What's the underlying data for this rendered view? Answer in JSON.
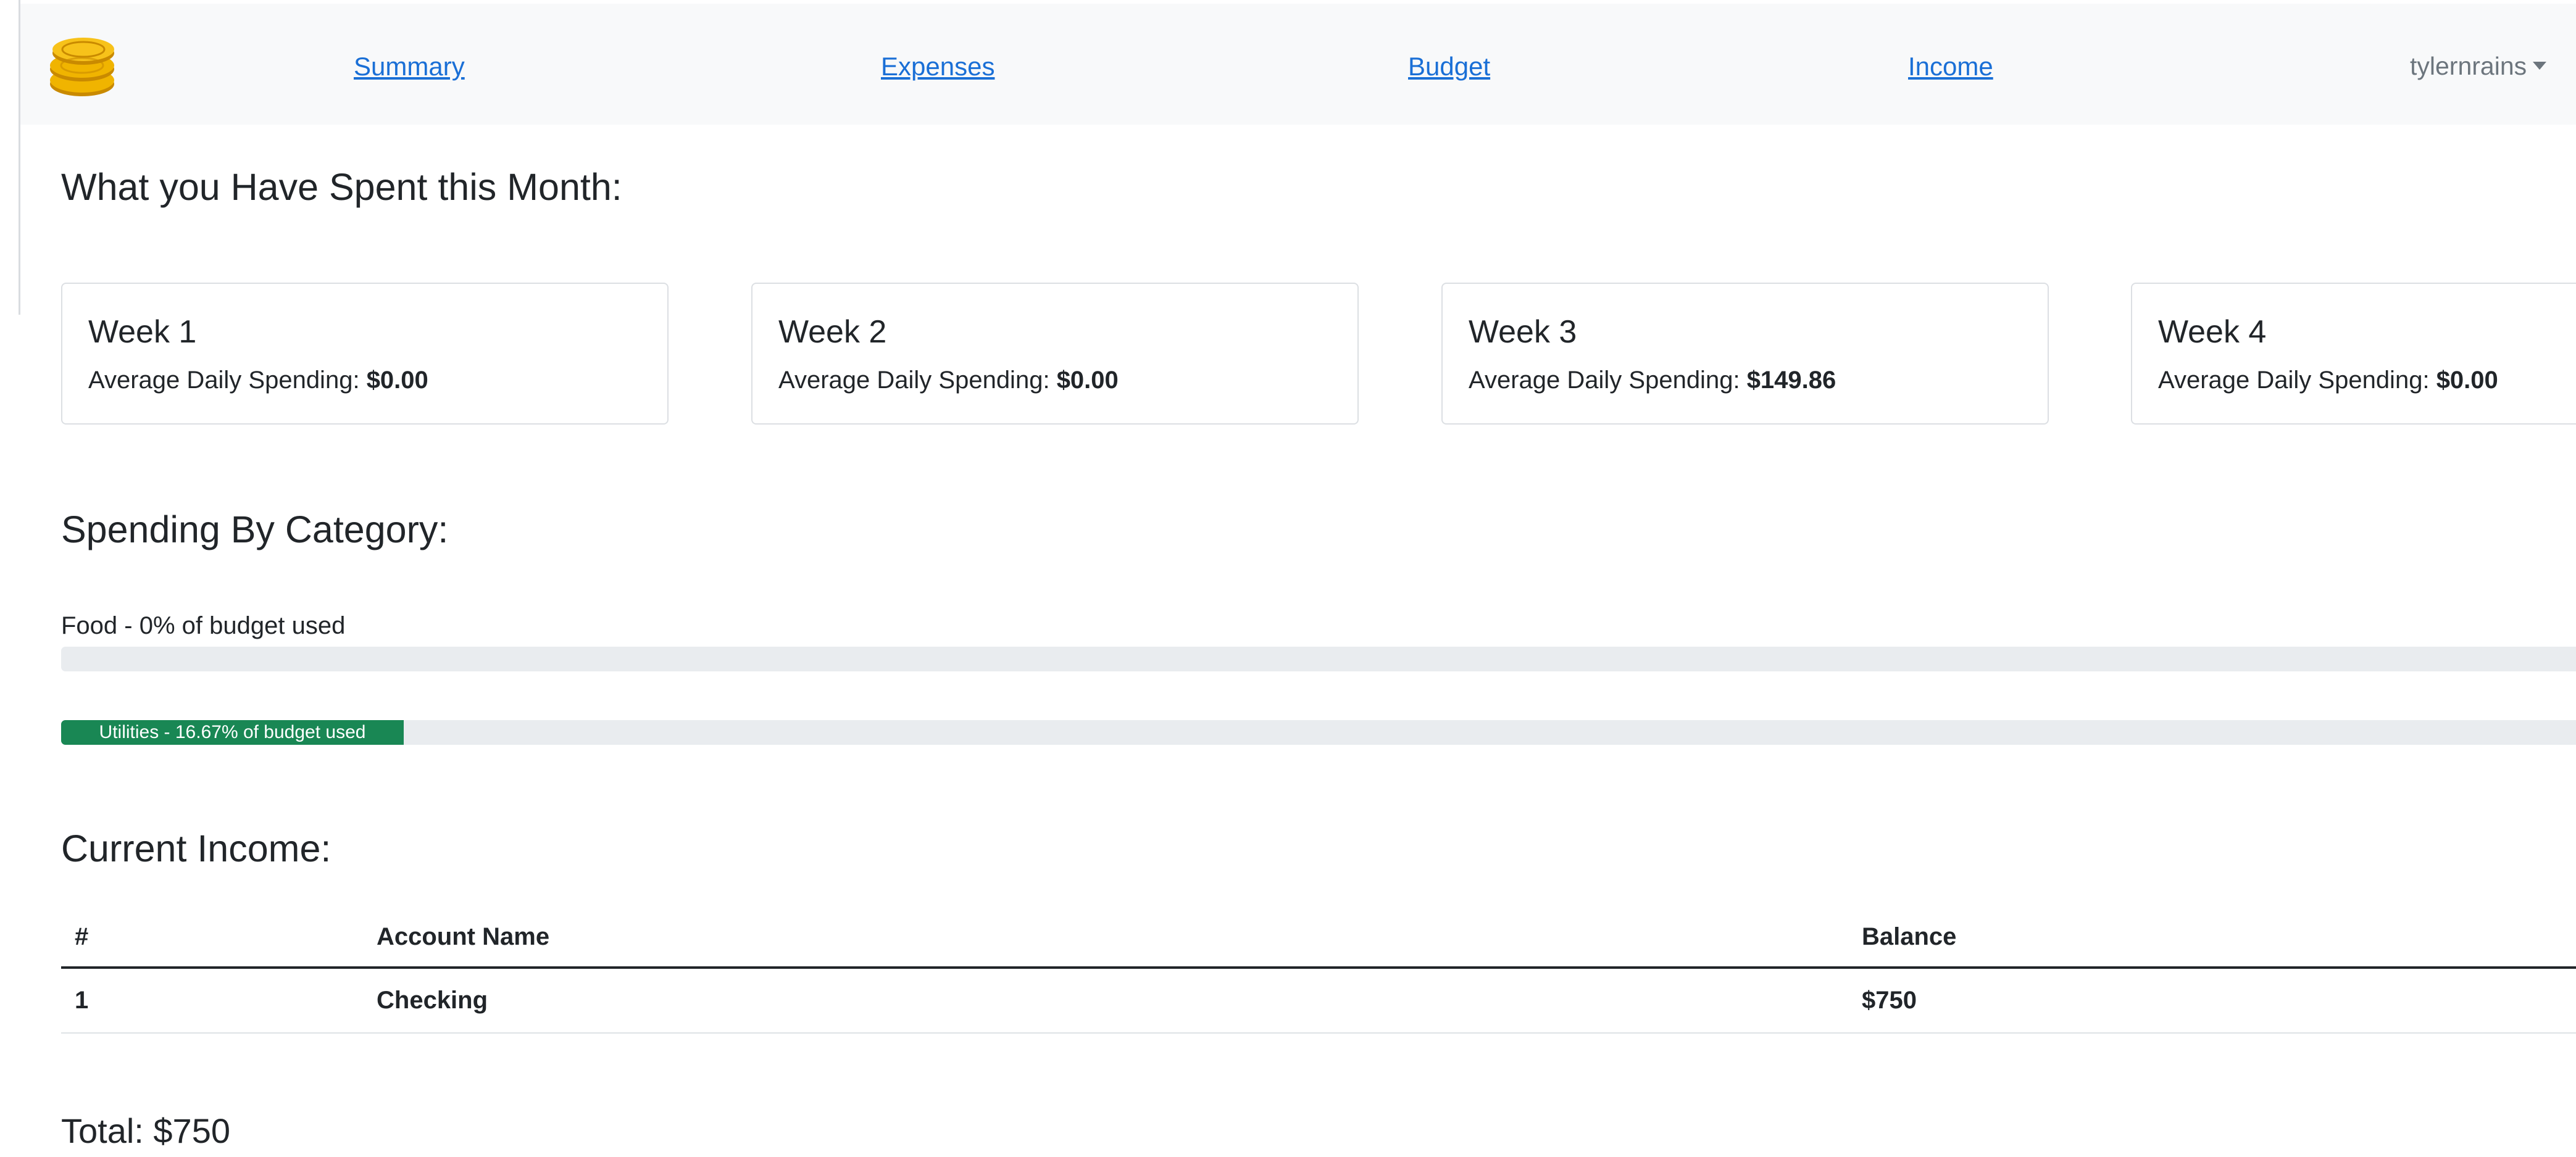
{
  "navbar": {
    "logo_icon": "coin-stack-icon",
    "links": [
      "Summary",
      "Expenses",
      "Budget",
      "Income"
    ],
    "user": "tylernrains"
  },
  "weekly": {
    "heading": "What you Have Spent this Month:",
    "label": "Average Daily Spending:",
    "weeks": [
      {
        "title": "Week 1",
        "amount": "$0.00"
      },
      {
        "title": "Week 2",
        "amount": "$0.00"
      },
      {
        "title": "Week 3",
        "amount": "$149.86"
      },
      {
        "title": "Week 4",
        "amount": "$0.00"
      }
    ]
  },
  "categories": {
    "heading": "Spending By Category:",
    "items": [
      {
        "label": "Food - 0% of budget used",
        "percent": 0
      },
      {
        "label": "Utilities - 16.67% of budget used",
        "percent": 16.67
      }
    ],
    "fill_color": "#198754",
    "track_color": "#e9ecef"
  },
  "income": {
    "heading": "Current Income:",
    "columns": [
      "#",
      "Account Name",
      "Balance"
    ],
    "rows": [
      [
        "1",
        "Checking",
        "$750"
      ]
    ],
    "total": "Total: $750"
  },
  "colors": {
    "link": "#1a6fd6",
    "navbar_bg": "#f8f9fa"
  }
}
